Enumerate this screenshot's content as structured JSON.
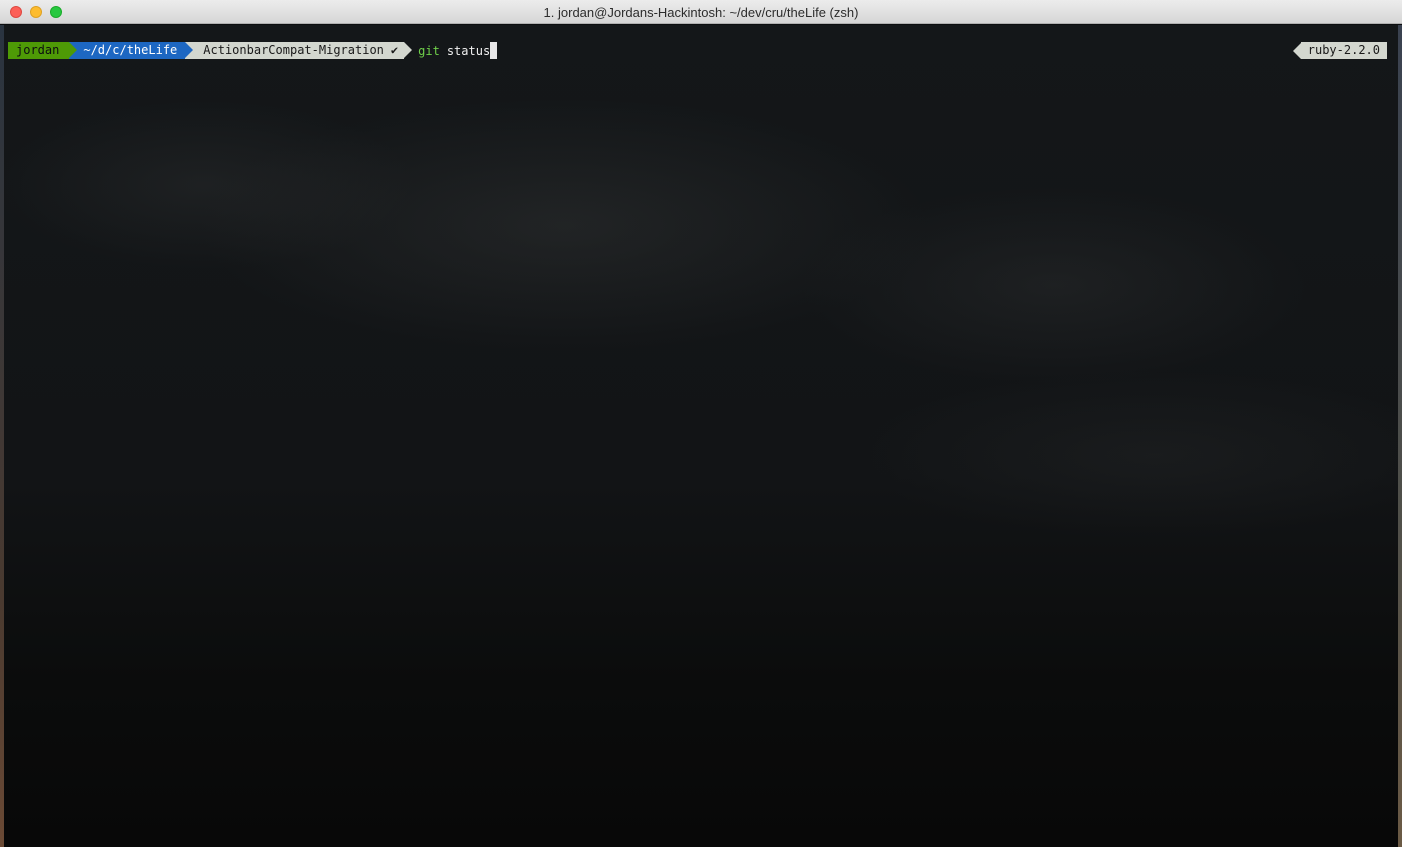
{
  "window": {
    "title": "1. jordan@Jordans-Hackintosh: ~/dev/cru/theLife (zsh)"
  },
  "prompt": {
    "user": "jordan",
    "path": "~/d/c/theLife",
    "branch_icon": "",
    "branch": "ActionbarCompat-Migration",
    "status_icon": "✔",
    "command": "git",
    "argument": "status"
  },
  "right_prompt": {
    "ruby_version": "ruby-2.2.0"
  },
  "colors": {
    "user_segment": "#4e9a06",
    "path_segment": "#1d67c2",
    "git_segment": "#d3d7cf",
    "command_green": "#6fcf4a"
  },
  "icons": {
    "close": "close-button",
    "minimize": "minimize-button",
    "maximize": "maximize-button",
    "branch": "git-branch-icon",
    "status": "checkmark-icon"
  }
}
